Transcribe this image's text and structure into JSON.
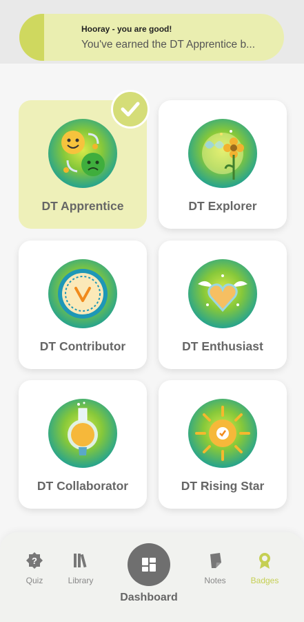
{
  "toast": {
    "title": "Hooray - you are good!",
    "message": "You've earned the DT Apprentice b..."
  },
  "badges": [
    {
      "label": "DT Apprentice",
      "icon": "faces-emotions-icon",
      "earned": true
    },
    {
      "label": "DT Explorer",
      "icon": "butterfly-flower-icon",
      "earned": false
    },
    {
      "label": "DT Contributor",
      "icon": "checkmark-seal-icon",
      "earned": false
    },
    {
      "label": "DT Enthusiast",
      "icon": "winged-heart-icon",
      "earned": false
    },
    {
      "label": "DT Collaborator",
      "icon": "lightbulb-flask-icon",
      "earned": false
    },
    {
      "label": "DT Rising Star",
      "icon": "sun-check-icon",
      "earned": false
    }
  ],
  "nav": {
    "quiz": "Quiz",
    "library": "Library",
    "dashboard": "Dashboard",
    "notes": "Notes",
    "badges": "Badges",
    "active": "Badges"
  },
  "colors": {
    "accent": "#cfd85f",
    "earned_card": "#eef0b9",
    "active_nav": "#c5cf53"
  }
}
